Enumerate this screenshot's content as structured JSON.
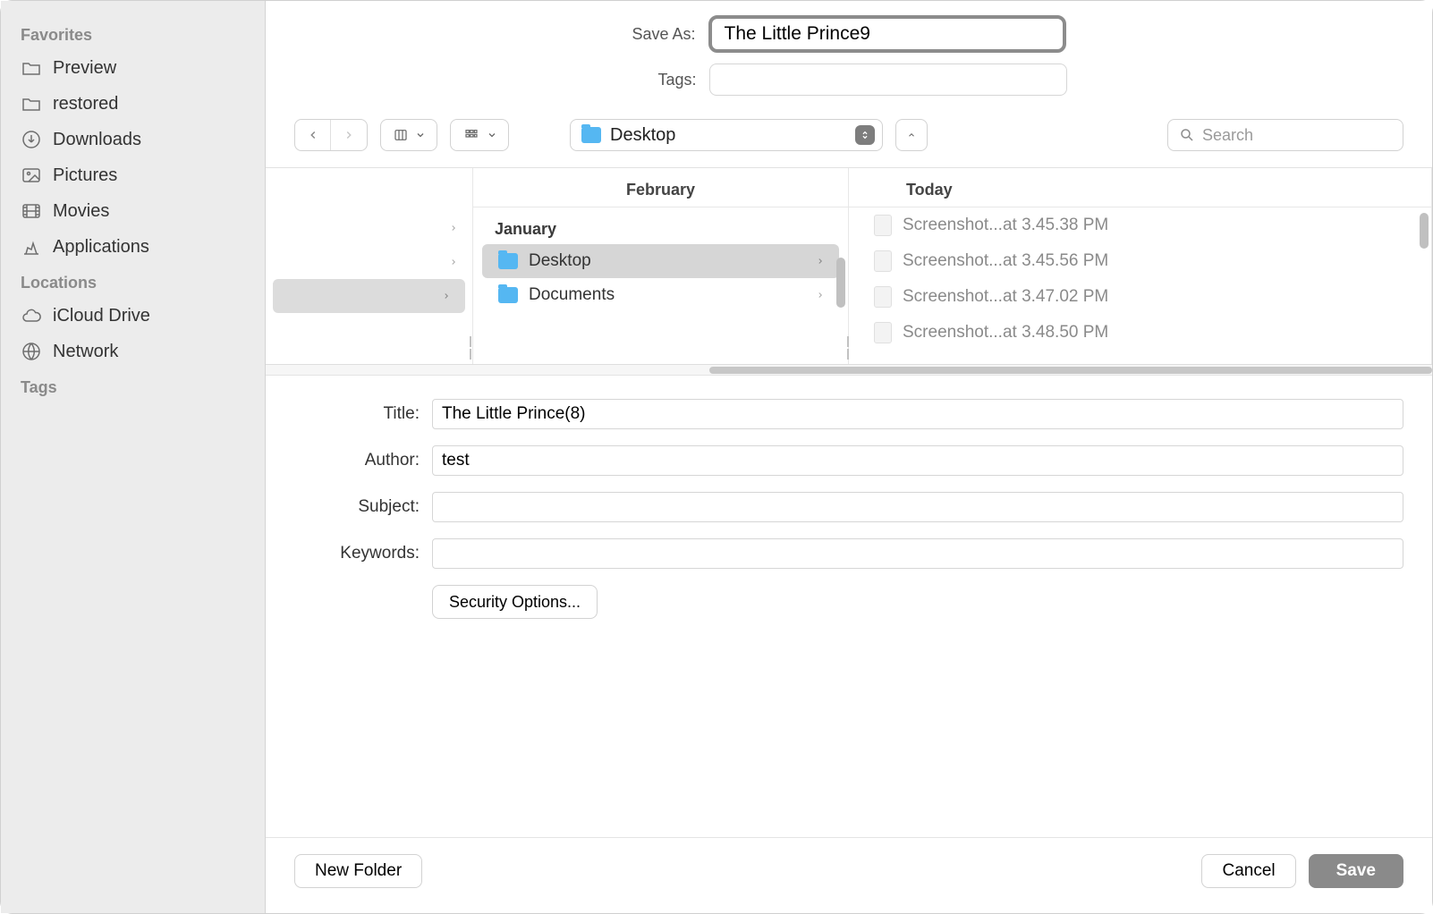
{
  "sidebar": {
    "section_favorites": "Favorites",
    "section_locations": "Locations",
    "section_tags": "Tags",
    "items": [
      {
        "label": "Preview",
        "icon": "folder-icon"
      },
      {
        "label": "restored",
        "icon": "folder-icon"
      },
      {
        "label": "Downloads",
        "icon": "download-icon"
      },
      {
        "label": "Pictures",
        "icon": "pictures-icon"
      },
      {
        "label": "Movies",
        "icon": "movies-icon"
      },
      {
        "label": "Applications",
        "icon": "applications-icon"
      }
    ],
    "locations": [
      {
        "label": "iCloud Drive",
        "icon": "cloud-icon"
      },
      {
        "label": "Network",
        "icon": "network-icon"
      }
    ]
  },
  "save_as": {
    "label": "Save As:",
    "value": "The Little Prince9"
  },
  "tags": {
    "label": "Tags:",
    "value": ""
  },
  "location_selector": {
    "value": "Desktop"
  },
  "search": {
    "placeholder": "Search"
  },
  "browser": {
    "col1": {
      "header": "February",
      "subheader": "January",
      "items": [
        {
          "label": "Desktop",
          "is_folder": true,
          "selected": true,
          "has_children": true
        },
        {
          "label": "Documents",
          "is_folder": true,
          "selected": false,
          "has_children": true
        }
      ]
    },
    "col2": {
      "header": "Today",
      "items": [
        {
          "label": "Screenshot...at 3.45.38 PM",
          "is_folder": false
        },
        {
          "label": "Screenshot...at 3.45.56 PM",
          "is_folder": false
        },
        {
          "label": "Screenshot...at 3.47.02 PM",
          "is_folder": false
        },
        {
          "label": "Screenshot...at 3.48.50 PM",
          "is_folder": false
        }
      ]
    }
  },
  "metadata": {
    "title": {
      "label": "Title:",
      "value": "The Little Prince(8)"
    },
    "author": {
      "label": "Author:",
      "value": "test"
    },
    "subject": {
      "label": "Subject:",
      "value": ""
    },
    "keywords": {
      "label": "Keywords:",
      "value": ""
    },
    "security_options_label": "Security Options..."
  },
  "footer": {
    "new_folder": "New Folder",
    "cancel": "Cancel",
    "save": "Save"
  }
}
